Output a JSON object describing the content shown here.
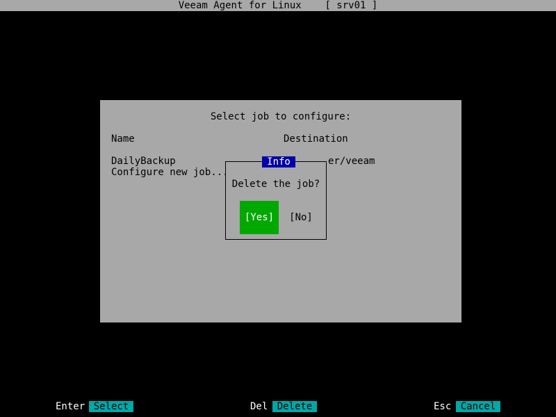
{
  "titlebar": {
    "app": "Veeam Agent for Linux",
    "host": "[ srv01 ]"
  },
  "panel": {
    "heading": "Select job to configure:",
    "columns": {
      "name": "Name",
      "destination": "Destination"
    },
    "rows": [
      {
        "name": "DailyBackup",
        "destination": "er/veeam"
      },
      {
        "name": "Configure new job...",
        "destination": ""
      }
    ]
  },
  "dialog": {
    "title": "Info",
    "message": "Delete the job?",
    "yes_label": "[Yes]",
    "no_label": "[No]",
    "focused_button": "yes"
  },
  "hotkeys": [
    {
      "key": "Enter",
      "action": "Select"
    },
    {
      "key": "Del",
      "action": "Delete"
    },
    {
      "key": "Esc",
      "action": "Cancel"
    }
  ],
  "colors": {
    "screen_bg": "#000000",
    "panel_bg": "#a8a8a8",
    "dialog_title_bg": "#0000a8",
    "focused_button_bg": "#00a800",
    "hotkey_bg": "#00a8a8"
  }
}
